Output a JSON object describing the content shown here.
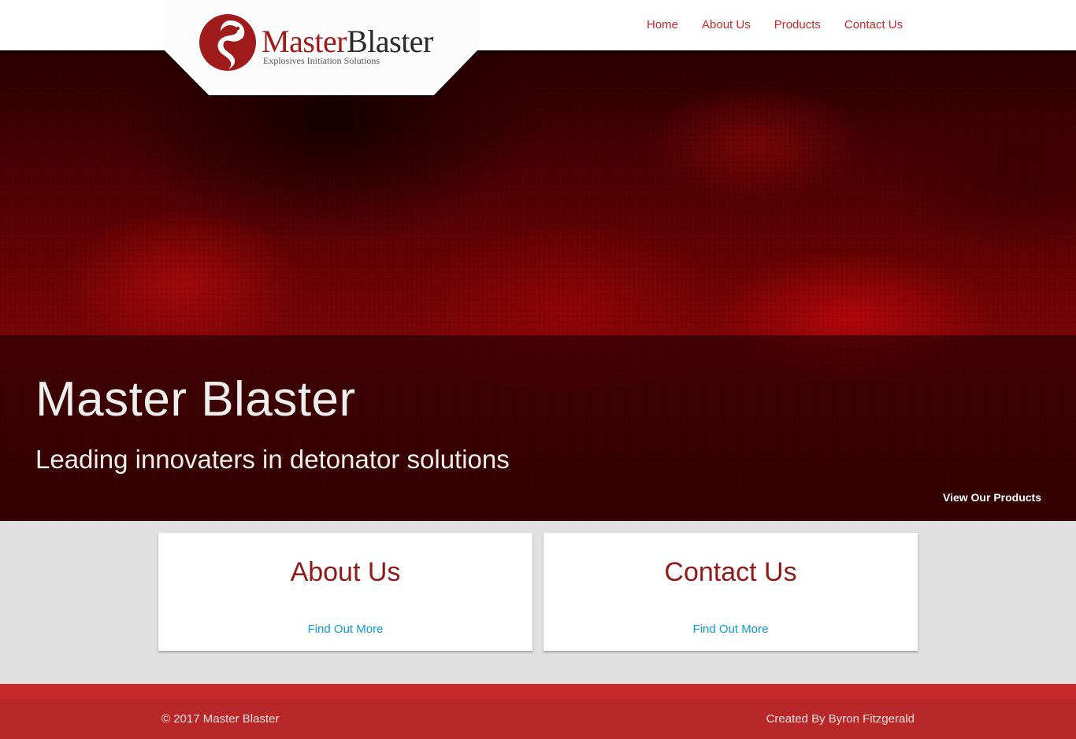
{
  "header": {
    "logo": {
      "word_part1": "Master",
      "word_part2": "Blaster",
      "tagline": "Explosives Initiation Solutions"
    },
    "nav": [
      {
        "label": "Home"
      },
      {
        "label": "About Us"
      },
      {
        "label": "Products"
      },
      {
        "label": "Contact Us"
      }
    ]
  },
  "hero": {
    "title": "Master Blaster",
    "subtitle": "Leading innovaters in detonator solutions",
    "cta_label": "View Our Products"
  },
  "cards": [
    {
      "title": "About Us",
      "link_label": "Find Out More"
    },
    {
      "title": "Contact Us",
      "link_label": "Find Out More"
    }
  ],
  "footer": {
    "copyright": "© 2017 Master Blaster",
    "credit": "Created By Byron Fitzgerald"
  },
  "colors": {
    "brand_red": "#c62828",
    "logo_red": "#a01c1c",
    "card_title": "#8e1b1b",
    "link_blue": "#0d9ad8",
    "footer_bg": "#b82828",
    "page_bg": "#e0e0e0"
  },
  "icons": {
    "logo_mark": "dragon-emblem-icon"
  }
}
